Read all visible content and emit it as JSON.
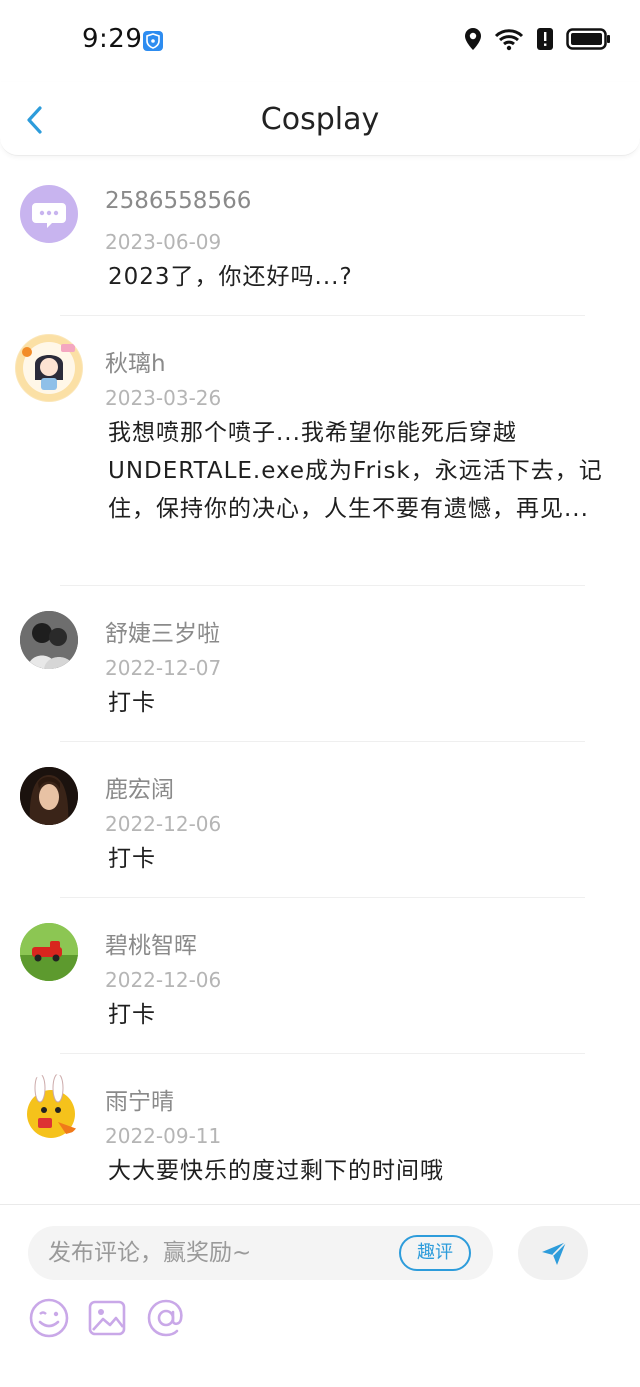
{
  "status_bar": {
    "time": "9:29",
    "icons": [
      "shield-icon",
      "location-icon",
      "wifi-icon",
      "alert-icon",
      "battery-icon"
    ]
  },
  "header": {
    "title": "Cosplay",
    "back_icon": "chevron-left-icon"
  },
  "comments": [
    {
      "author": "2586558566",
      "date": "2023-06-09",
      "content": "2023了，你还好吗...?",
      "avatar": "default-chat-avatar"
    },
    {
      "author": "秋璃h",
      "date": "2023-03-26",
      "content": "我想喷那个喷子...我希望你能死后穿越UNDERTALE.exe成为Frisk，永远活下去，记住，保持你的决心，人生不要有遗憾，再见...",
      "avatar": "anime-girl-avatar"
    },
    {
      "author": "舒婕三岁啦",
      "date": "2022-12-07",
      "content": "打卡",
      "avatar": "couple-photo-avatar"
    },
    {
      "author": "鹿宏阔",
      "date": "2022-12-06",
      "content": "打卡",
      "avatar": "portrait-avatar"
    },
    {
      "author": "碧桃智晖",
      "date": "2022-12-06",
      "content": "打卡",
      "avatar": "toy-car-avatar"
    },
    {
      "author": "雨宁晴",
      "date": "2022-09-11",
      "content": "大大要快乐的度过剩下的时间哦",
      "avatar": "cartoon-bunny-avatar"
    }
  ],
  "footer": {
    "placeholder": "发布评论，赢奖励~",
    "badge": "趣评",
    "send_icon": "send-icon",
    "tools": [
      "emoji-icon",
      "image-icon",
      "mention-icon"
    ]
  },
  "colors": {
    "accent": "#2d9cdb",
    "tool_purple": "#c9a8e8",
    "avatar_purple": "#c8b4ef"
  }
}
